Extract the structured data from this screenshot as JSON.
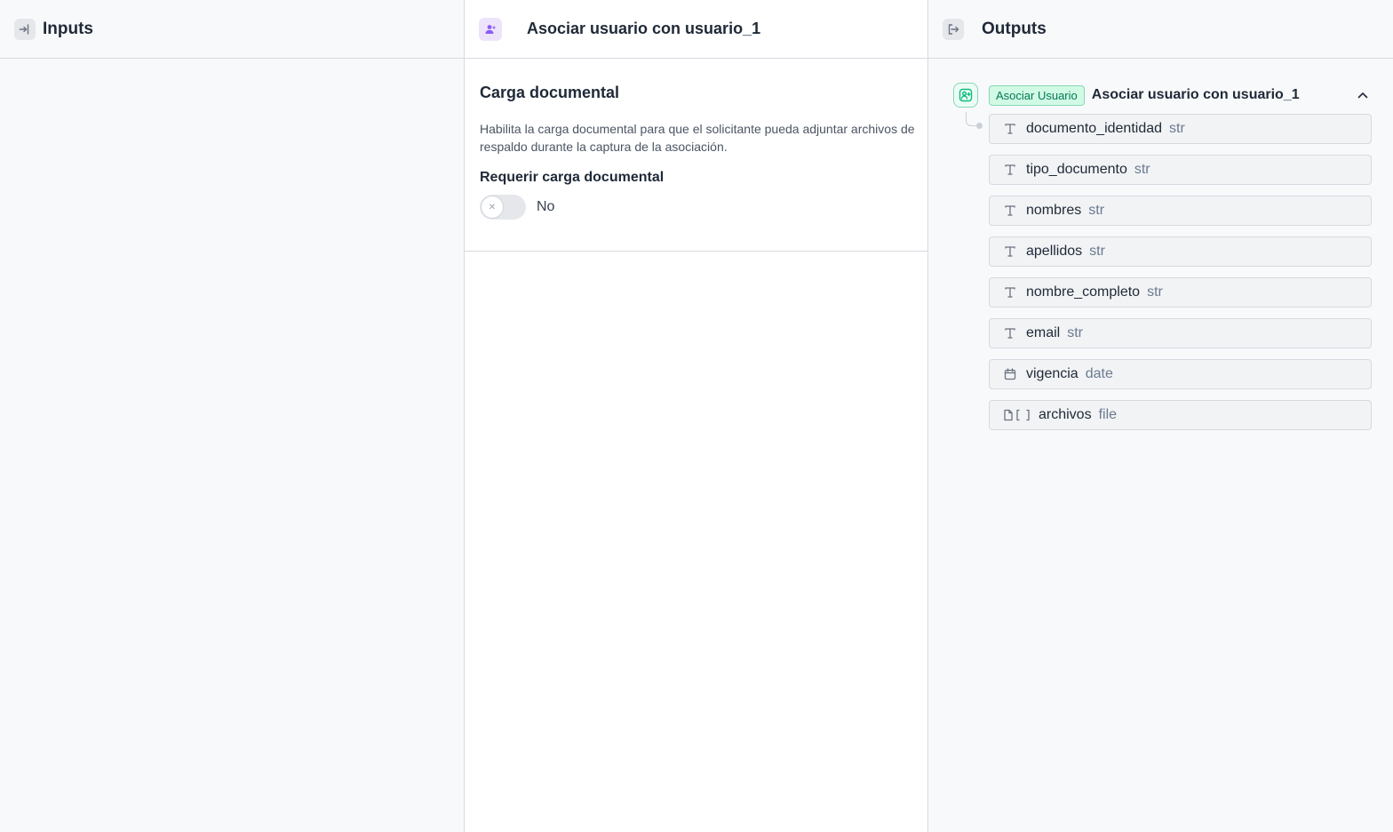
{
  "inputs_panel": {
    "title": "Inputs",
    "icon": "log-in-icon"
  },
  "editor_panel": {
    "title": "Asociar usuario con usuario_1",
    "icon": "user-plus-icon",
    "section": {
      "title": "Carga documental",
      "description": "Habilita la carga documental para que el solicitante pueda adjuntar archivos de respaldo durante la captura de la asociación.",
      "field_label": "Requerir carga documental",
      "toggle_value": "No",
      "toggle_on": false
    }
  },
  "outputs_panel": {
    "title": "Outputs",
    "icon": "log-out-icon",
    "node": {
      "badge": "Asociar Usuario",
      "name": "Asociar usuario con usuario_1",
      "expanded": true,
      "fields": [
        {
          "name": "documento_identidad",
          "type": "str",
          "icon": "text-type-icon"
        },
        {
          "name": "tipo_documento",
          "type": "str",
          "icon": "text-type-icon"
        },
        {
          "name": "nombres",
          "type": "str",
          "icon": "text-type-icon"
        },
        {
          "name": "apellidos",
          "type": "str",
          "icon": "text-type-icon"
        },
        {
          "name": "nombre_completo",
          "type": "str",
          "icon": "text-type-icon"
        },
        {
          "name": "email",
          "type": "str",
          "icon": "text-type-icon"
        },
        {
          "name": "vigencia",
          "type": "date",
          "icon": "calendar-icon"
        },
        {
          "name": "archivos",
          "type": "file",
          "icon": "file-array-icon"
        }
      ]
    }
  },
  "colors": {
    "accent_purple": "#ede4fb",
    "accent_green": "#047857",
    "badge_bg": "#d1fae5",
    "border": "#d6dae0"
  }
}
